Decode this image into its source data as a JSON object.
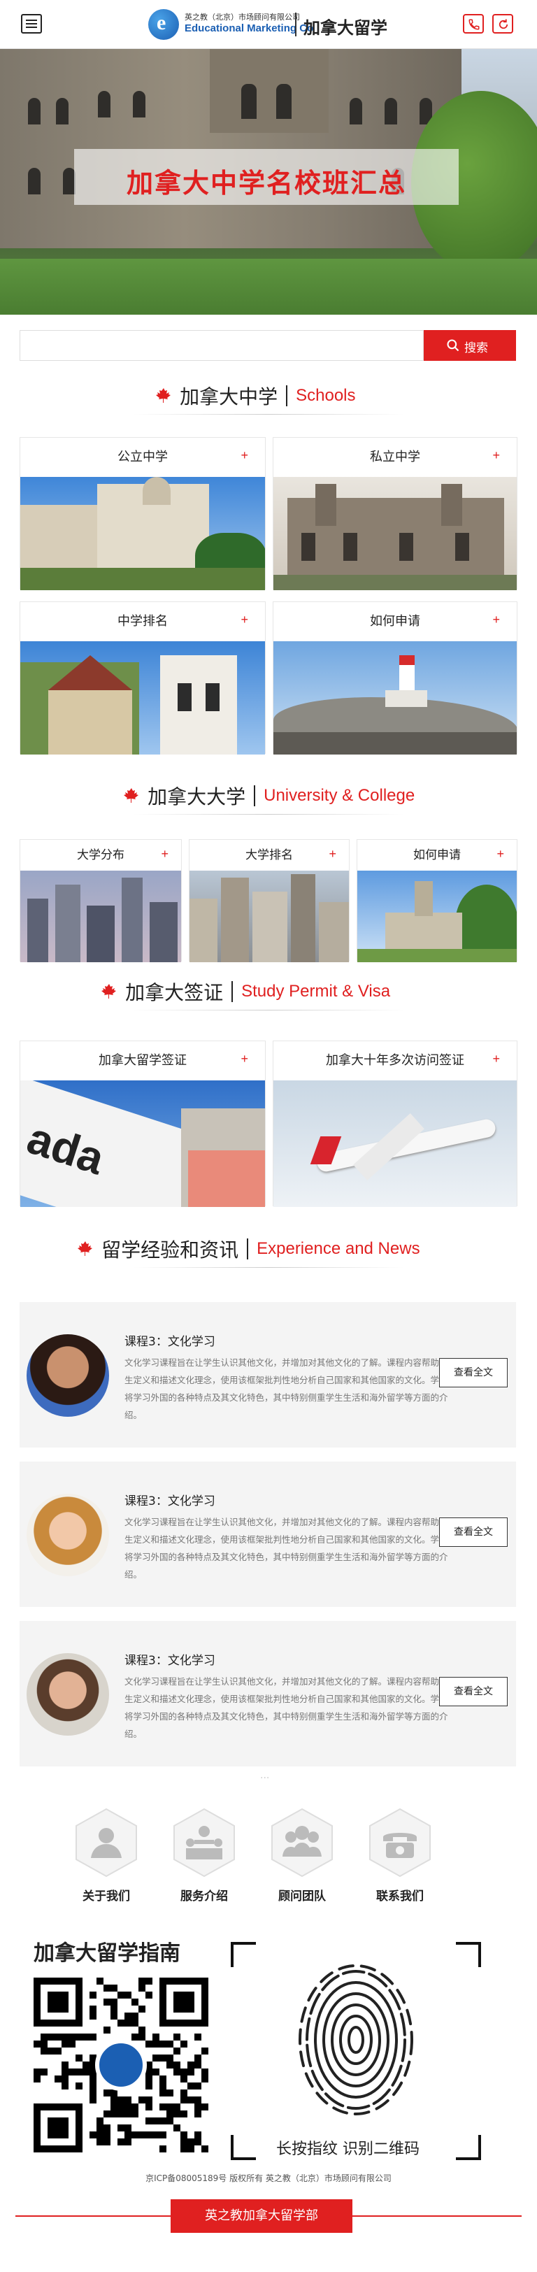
{
  "header": {
    "logo_cn": "英之教（北京）市场顾问有限公司",
    "logo_en": "Educational Marketing Co",
    "logo_letter": "e",
    "title": "加拿大留学",
    "menu_icon": "menu-icon",
    "phone_icon": "phone-icon",
    "refresh_icon": "refresh-icon"
  },
  "banner": {
    "title": "加拿大中学名校班汇总"
  },
  "search": {
    "placeholder": "",
    "button_label": "搜索"
  },
  "sections": {
    "schools": {
      "cn": "加拿大中学",
      "en": "Schools",
      "cards": [
        {
          "label": "公立中学",
          "plus": "+"
        },
        {
          "label": "私立中学",
          "plus": "+"
        },
        {
          "label": "中学排名",
          "plus": "+"
        },
        {
          "label": "如何申请",
          "plus": "+"
        }
      ]
    },
    "university": {
      "cn": "加拿大大学",
      "en": "University & College",
      "cards": [
        {
          "label": "大学分布",
          "plus": "+"
        },
        {
          "label": "大学排名",
          "plus": "+"
        },
        {
          "label": "如何申请",
          "plus": "+"
        }
      ]
    },
    "visa": {
      "cn": "加拿大签证",
      "en": "Study Permit & Visa",
      "cards": [
        {
          "label": "加拿大留学签证",
          "plus": "+"
        },
        {
          "label": "加拿大十年多次访问签证",
          "plus": "+"
        }
      ]
    },
    "news": {
      "cn": "留学经验和资讯",
      "en": "Experience and News",
      "items": [
        {
          "title": "课程3：文化学习",
          "body": "文化学习课程旨在让学生认识其他文化，并增加对其他文化的了解。课程内容帮助学生定义和描述文化理念，使用该框架批判性地分析自己国家和其他国家的文化。学生将学习外国的各种特点及其文化特色，其中特别侧重学生生活和海外留学等方面的介绍。",
          "more": "查看全文"
        },
        {
          "title": "课程3：文化学习",
          "body": "文化学习课程旨在让学生认识其他文化，并增加对其他文化的了解。课程内容帮助学生定义和描述文化理念，使用该框架批判性地分析自己国家和其他国家的文化。学生将学习外国的各种特点及其文化特色，其中特别侧重学生生活和海外留学等方面的介绍。",
          "more": "查看全文"
        },
        {
          "title": "课程3：文化学习",
          "body": "文化学习课程旨在让学生认识其他文化，并增加对其他文化的了解。课程内容帮助学生定义和描述文化理念，使用该框架批判性地分析自己国家和其他国家的文化。学生将学习外国的各种特点及其文化特色，其中特别侧重学生生活和海外留学等方面的介绍。",
          "more": "查看全文"
        }
      ]
    }
  },
  "footer_nav": [
    {
      "label": "关于我们",
      "icon": "about-us-icon"
    },
    {
      "label": "服务介绍",
      "icon": "service-icon"
    },
    {
      "label": "顾问团队",
      "icon": "team-icon"
    },
    {
      "label": "联系我们",
      "icon": "contact-icon"
    }
  ],
  "guide": {
    "title": "加拿大留学指南",
    "scan_text": "长按指纹 识别二维码"
  },
  "copyright": "京ICP备08005189号 版权所有 英之教（北京）市场顾问有限公司",
  "bottom_button": "英之教加拿大留学部",
  "colors": {
    "accent": "#e02020",
    "logo_blue": "#1b5fb3"
  }
}
